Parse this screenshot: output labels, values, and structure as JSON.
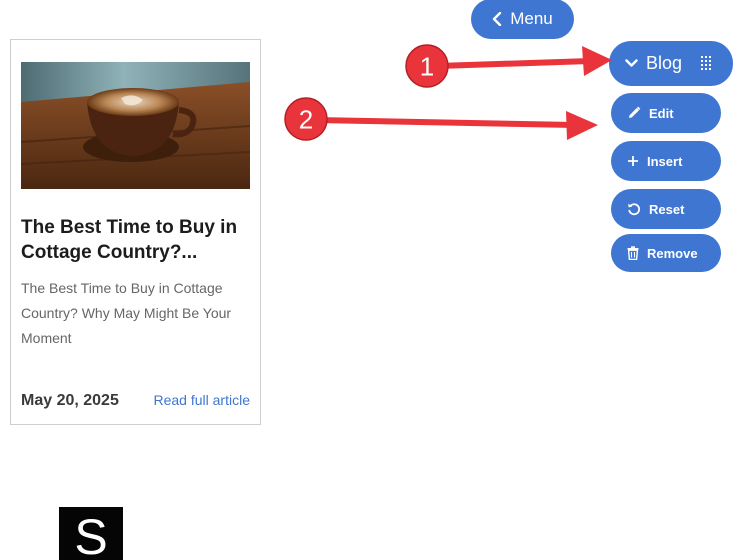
{
  "toolbar": {
    "menu_label": "Menu",
    "blog_label": "Blog",
    "actions": {
      "edit": "Edit",
      "insert": "Insert",
      "reset": "Reset",
      "remove": "Remove"
    }
  },
  "card": {
    "title": "The Best Time to Buy in Cottage Country?...",
    "excerpt": "The Best Time to Buy in Cottage Country? Why May Might Be Your Moment",
    "date": "May 20, 2025",
    "read_more": "Read full article"
  },
  "annotations": {
    "badge1": "1",
    "badge2": "2"
  },
  "logo": {
    "letter": "S"
  },
  "colors": {
    "accent": "#3f76d2",
    "annotation": "#e8343a",
    "text_dark": "#1c1c1c",
    "text_muted": "#666666"
  },
  "icons": {
    "menu": "chevron-left-icon",
    "blog": "chevron-down-icon",
    "drag": "drag-grid-icon",
    "edit": "pencil-icon",
    "insert": "plus-icon",
    "reset": "undo-icon",
    "remove": "trash-icon"
  }
}
